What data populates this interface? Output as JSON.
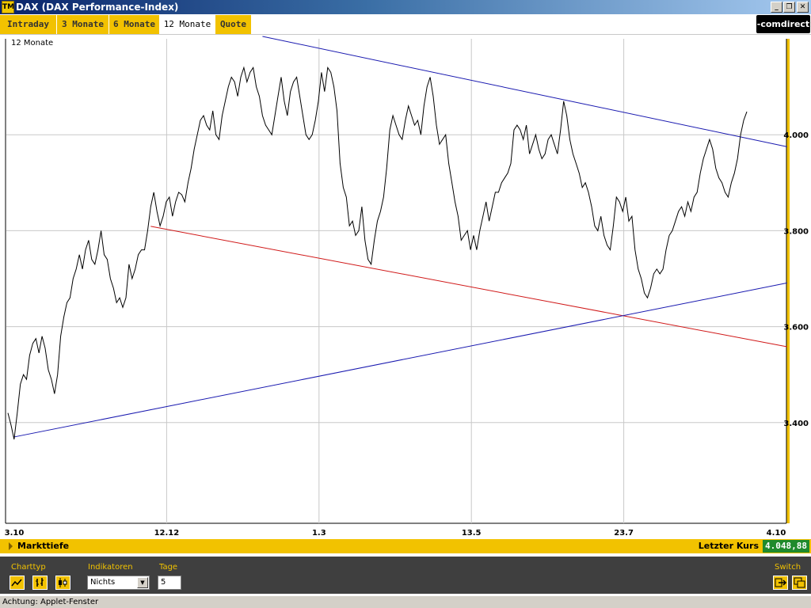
{
  "window": {
    "app_icon_text": "TM",
    "title": "DAX (DAX Performance-Index)",
    "btn_minimize": "_",
    "btn_restore": "❐",
    "btn_close": "✕"
  },
  "tabs": [
    {
      "label": "Intraday"
    },
    {
      "label": "3 Monate"
    },
    {
      "label": "6 Monate"
    },
    {
      "label": "12 Monate"
    },
    {
      "label": "Quote"
    }
  ],
  "logo": {
    "text": "-comdirect"
  },
  "chart_data": {
    "type": "line",
    "period_label": "12 Monate",
    "x_ticks": [
      "3.10",
      "12.12",
      "1.3",
      "13.5",
      "23.7",
      "4.10"
    ],
    "y_ticks": [
      3400,
      3600,
      3800,
      4000
    ],
    "y_tick_labels": [
      "3.400",
      "3.600",
      "3.800",
      "4.000"
    ],
    "ylim": [
      3190,
      4200
    ],
    "grid": true,
    "series_color": "#000000",
    "x_index_max": 250,
    "series": [
      {
        "values": [
          3420,
          3395,
          3365,
          3420,
          3480,
          3500,
          3490,
          3540,
          3565,
          3575,
          3545,
          3580,
          3555,
          3510,
          3490,
          3460,
          3500,
          3580,
          3620,
          3650,
          3660,
          3700,
          3720,
          3750,
          3720,
          3760,
          3780,
          3740,
          3730,
          3760,
          3800,
          3750,
          3740,
          3700,
          3680,
          3650,
          3660,
          3640,
          3660,
          3730,
          3700,
          3720,
          3750,
          3760,
          3760,
          3800,
          3850,
          3880,
          3840,
          3810,
          3830,
          3860,
          3870,
          3830,
          3860,
          3880,
          3875,
          3860,
          3900,
          3930,
          3970,
          4000,
          4030,
          4040,
          4020,
          4010,
          4050,
          4000,
          3990,
          4040,
          4070,
          4100,
          4120,
          4110,
          4080,
          4120,
          4140,
          4110,
          4130,
          4140,
          4100,
          4080,
          4040,
          4020,
          4010,
          4000,
          4040,
          4080,
          4120,
          4070,
          4040,
          4090,
          4110,
          4120,
          4080,
          4040,
          4000,
          3990,
          4000,
          4030,
          4070,
          4130,
          4090,
          4140,
          4130,
          4100,
          4050,
          3940,
          3890,
          3870,
          3810,
          3820,
          3790,
          3800,
          3850,
          3780,
          3740,
          3730,
          3780,
          3820,
          3840,
          3870,
          3930,
          4010,
          4040,
          4020,
          4000,
          3990,
          4030,
          4060,
          4040,
          4020,
          4030,
          4000,
          4060,
          4100,
          4120,
          4080,
          4020,
          3980,
          3990,
          4000,
          3940,
          3900,
          3860,
          3830,
          3780,
          3790,
          3800,
          3760,
          3790,
          3760,
          3800,
          3830,
          3860,
          3820,
          3850,
          3880,
          3880,
          3900,
          3910,
          3920,
          3940,
          4010,
          4020,
          4010,
          3990,
          4020,
          3960,
          3980,
          4000,
          3970,
          3950,
          3960,
          3990,
          4000,
          3980,
          3960,
          4010,
          4070,
          4040,
          3990,
          3960,
          3940,
          3920,
          3890,
          3900,
          3880,
          3850,
          3810,
          3800,
          3830,
          3790,
          3770,
          3760,
          3810,
          3870,
          3860,
          3840,
          3870,
          3820,
          3830,
          3760,
          3720,
          3700,
          3670,
          3660,
          3680,
          3710,
          3720,
          3710,
          3720,
          3760,
          3790,
          3800,
          3820,
          3840,
          3850,
          3830,
          3860,
          3840,
          3870,
          3880,
          3920,
          3950,
          3970,
          3990,
          3970,
          3930,
          3910,
          3900,
          3880,
          3870,
          3900,
          3920,
          3950,
          4000,
          4030,
          4048
        ]
      }
    ],
    "trendlines": [
      {
        "color": "#1a1ab0",
        "x0": 82,
        "y0": 4205,
        "x1": 251,
        "y1": 3975
      },
      {
        "color": "#d01818",
        "x0": 46,
        "y0": 3809,
        "x1": 251,
        "y1": 3558
      },
      {
        "color": "#1a1ab0",
        "x0": 2,
        "y0": 3370,
        "x1": 251,
        "y1": 3691
      }
    ]
  },
  "market_bar": {
    "depth_label": "Markttiefe",
    "last_price_label": "Letzter Kurs",
    "last_price_value": "4.048,88"
  },
  "controls": {
    "chart_type_label": "Charttyp",
    "indicators_label": "Indikatoren",
    "indicator_selected": "Nichts",
    "days_label": "Tage",
    "days_value": "5",
    "switch_label": "Switch"
  },
  "status": {
    "text": "Achtung: Applet-Fenster"
  }
}
